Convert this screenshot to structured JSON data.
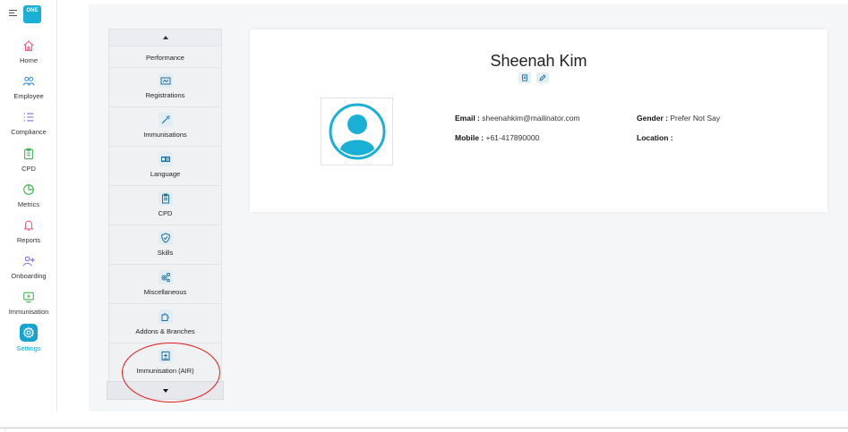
{
  "app": {
    "logo_text": "ONE"
  },
  "nav": [
    {
      "label": "Home",
      "icon": "home-icon"
    },
    {
      "label": "Employee",
      "icon": "users-icon"
    },
    {
      "label": "Compliance",
      "icon": "list-icon"
    },
    {
      "label": "CPD",
      "icon": "clipboard-icon"
    },
    {
      "label": "Metrics",
      "icon": "pie-chart-icon"
    },
    {
      "label": "Reports",
      "icon": "bell-icon"
    },
    {
      "label": "Onboarding",
      "icon": "user-plus-icon"
    },
    {
      "label": "Immunisation",
      "icon": "monitor-icon"
    },
    {
      "label": "Settings",
      "icon": "gear-icon",
      "active": true
    }
  ],
  "menu": {
    "items": [
      {
        "label": "Performance"
      },
      {
        "label": "Registrations"
      },
      {
        "label": "Immunisations"
      },
      {
        "label": "Language"
      },
      {
        "label": "CPD"
      },
      {
        "label": "Skills"
      },
      {
        "label": "Miscellaneous"
      },
      {
        "label": "Addons & Branches"
      },
      {
        "label": "Immunisation (AIR)"
      }
    ]
  },
  "profile": {
    "name": "Sheenah Kim",
    "email_label": "Email :",
    "email": "sheenahkim@mailinator.com",
    "mobile_label": "Mobile :",
    "mobile": "+61-417890000",
    "gender_label": "Gender :",
    "gender": "Prefer Not Say",
    "location_label": "Location :",
    "location": ""
  },
  "colors": {
    "accent": "#16a3cf",
    "highlight": "#e01b1b"
  }
}
